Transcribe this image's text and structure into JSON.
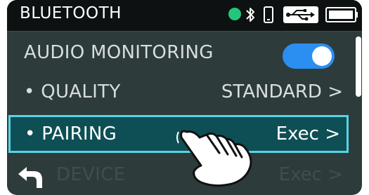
{
  "header": {
    "title": "BLUETOOTH",
    "icons": [
      "connected-dot-icon",
      "bluetooth-icon",
      "phone-icon",
      "usb-icon",
      "battery-icon"
    ],
    "connected_color": "#22c77a"
  },
  "menu": {
    "items": [
      {
        "label": "AUDIO MONITORING",
        "value": "",
        "toggle_on": true
      },
      {
        "label": "• QUALITY",
        "value": "STANDARD >"
      },
      {
        "label": "• PAIRING",
        "value": "Exec >",
        "selected": true
      },
      {
        "label": "DEVICE",
        "value": "Exec >"
      }
    ]
  },
  "colors": {
    "accent": "#2b8ef1",
    "selection_fill": "#0e4f55",
    "selection_border": "#57d4e6"
  },
  "gesture": {
    "icon": "tap-hand-icon"
  }
}
